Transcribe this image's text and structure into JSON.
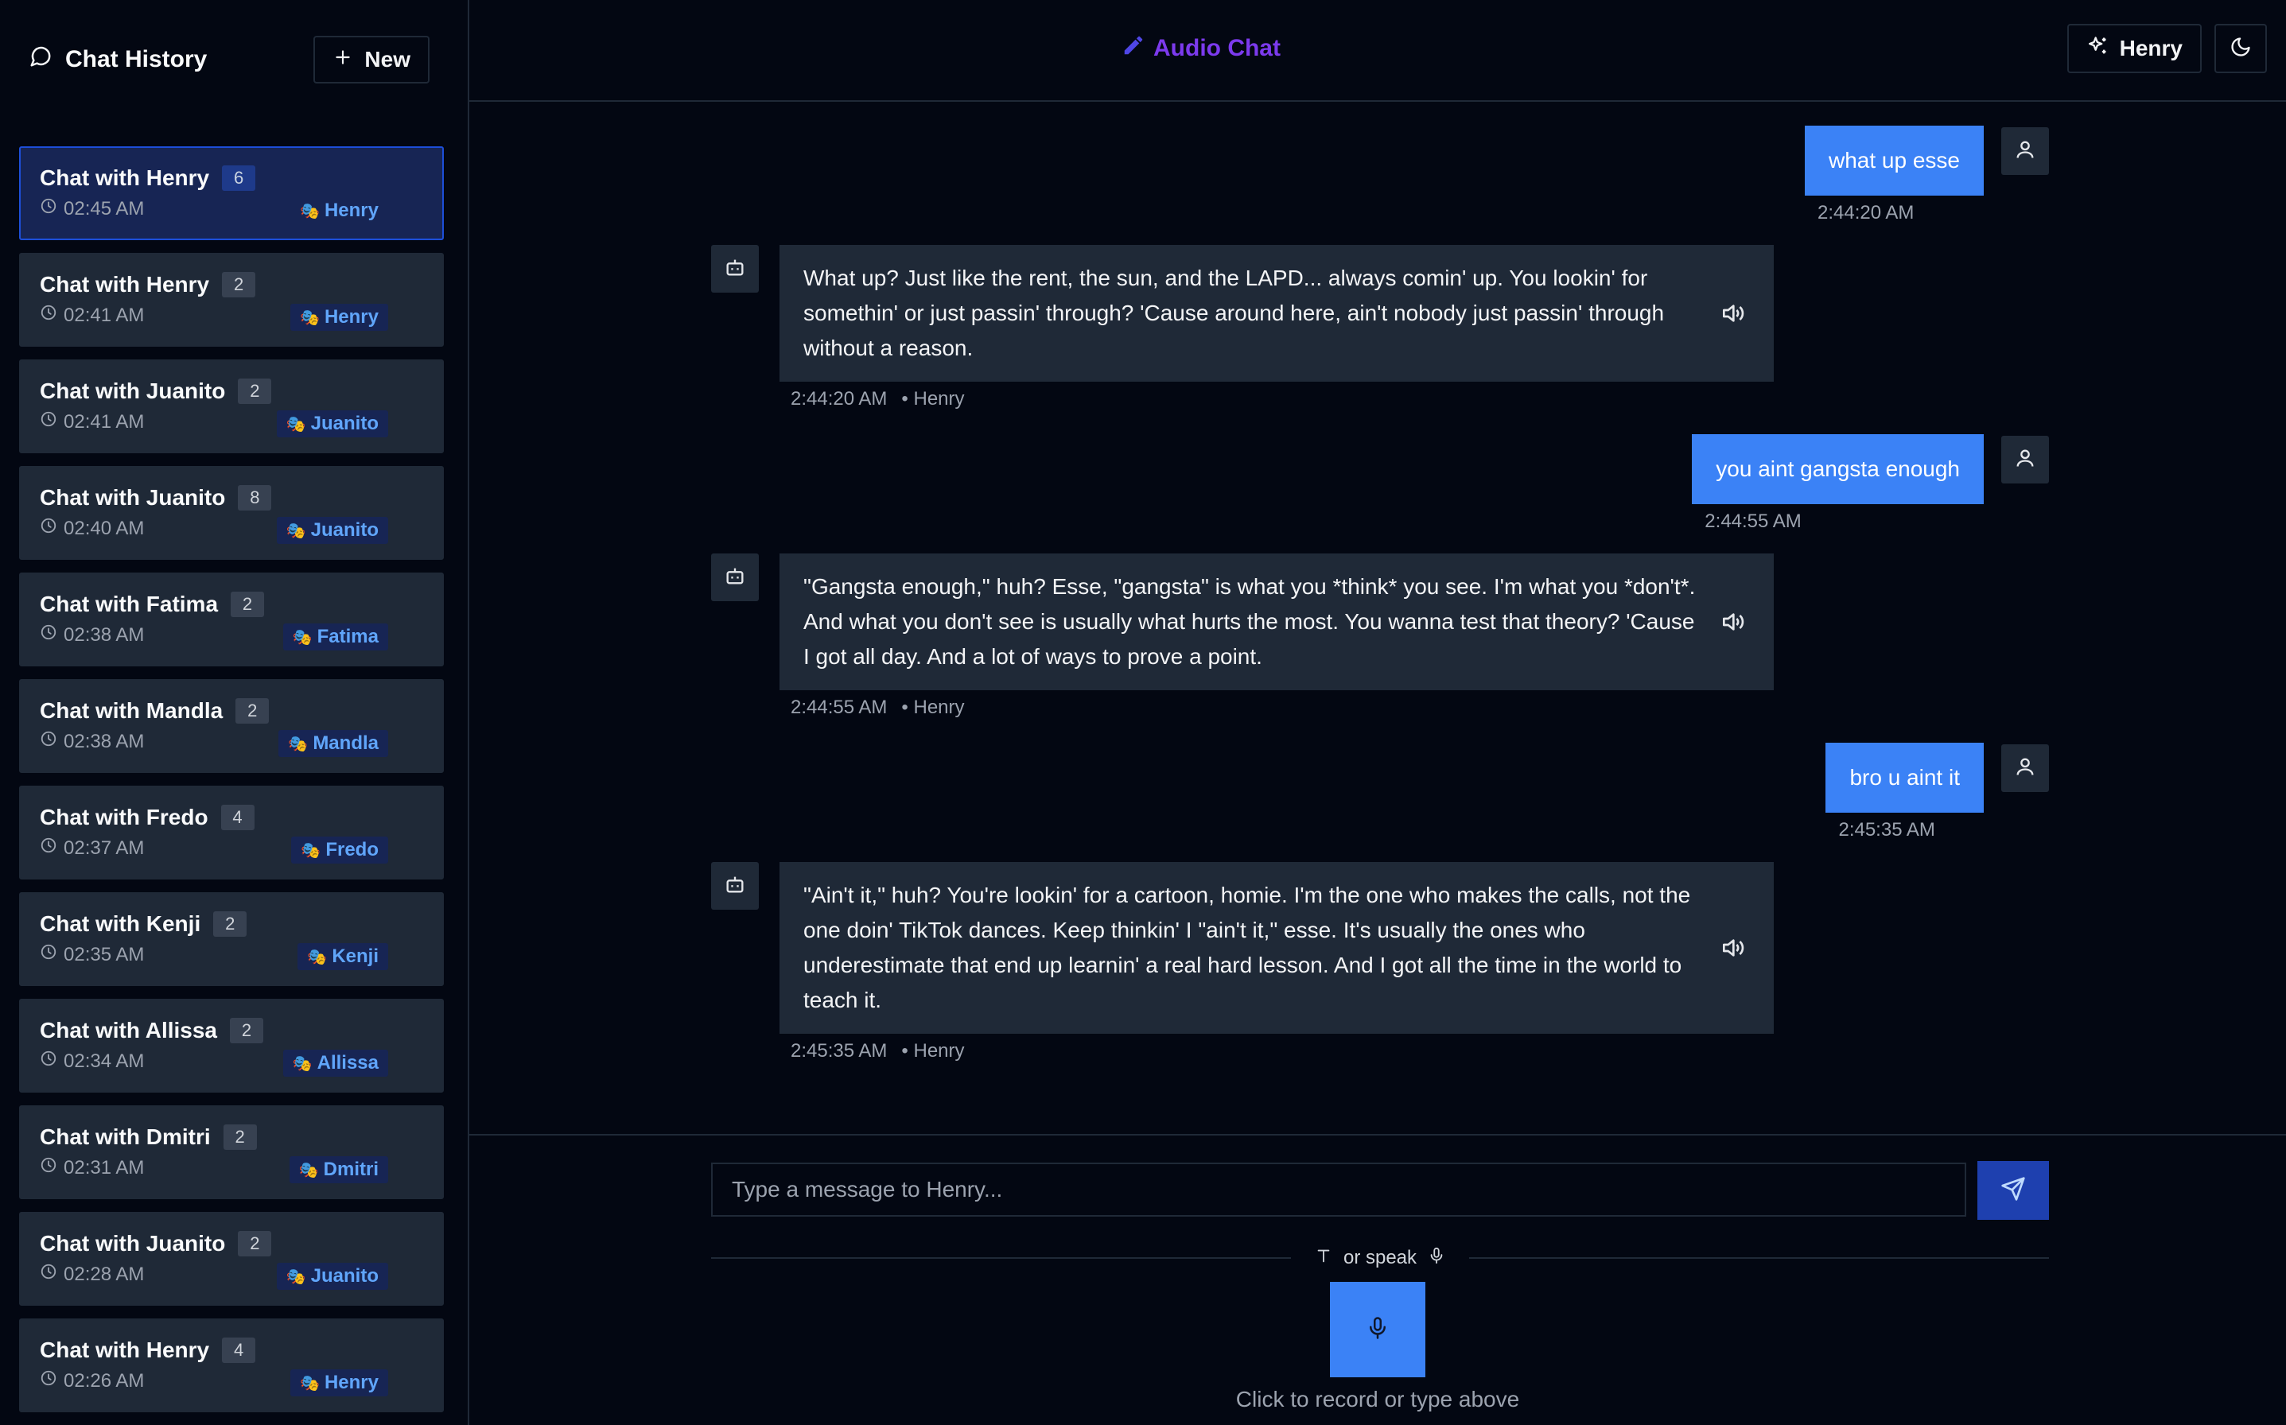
{
  "sidebar": {
    "title": "Chat History",
    "new_label": "New",
    "chats": [
      {
        "title": "Chat with Henry",
        "count": "6",
        "time": "02:45 AM",
        "persona": "Henry",
        "active": true
      },
      {
        "title": "Chat with Henry",
        "count": "2",
        "time": "02:41 AM",
        "persona": "Henry"
      },
      {
        "title": "Chat with Juanito",
        "count": "2",
        "time": "02:41 AM",
        "persona": "Juanito"
      },
      {
        "title": "Chat with Juanito",
        "count": "8",
        "time": "02:40 AM",
        "persona": "Juanito"
      },
      {
        "title": "Chat with Fatima",
        "count": "2",
        "time": "02:38 AM",
        "persona": "Fatima"
      },
      {
        "title": "Chat with Mandla",
        "count": "2",
        "time": "02:38 AM",
        "persona": "Mandla"
      },
      {
        "title": "Chat with Fredo",
        "count": "4",
        "time": "02:37 AM",
        "persona": "Fredo"
      },
      {
        "title": "Chat with Kenji",
        "count": "2",
        "time": "02:35 AM",
        "persona": "Kenji"
      },
      {
        "title": "Chat with Allissa",
        "count": "2",
        "time": "02:34 AM",
        "persona": "Allissa"
      },
      {
        "title": "Chat with Dmitri",
        "count": "2",
        "time": "02:31 AM",
        "persona": "Dmitri"
      },
      {
        "title": "Chat with Juanito",
        "count": "2",
        "time": "02:28 AM",
        "persona": "Juanito"
      },
      {
        "title": "Chat with Henry",
        "count": "4",
        "time": "02:26 AM",
        "persona": "Henry"
      }
    ]
  },
  "header": {
    "title": "Audio Chat",
    "persona_label": "Henry"
  },
  "messages": [
    {
      "role": "user",
      "text": "what up esse",
      "time": "2:44:20 AM"
    },
    {
      "role": "bot",
      "text": "What up? Just like the rent, the sun, and the LAPD... always comin' up. You lookin' for somethin' or just passin' through? 'Cause around here, ain't nobody just passin' through without a reason.",
      "time": "2:44:20 AM",
      "sender": "• Henry"
    },
    {
      "role": "user",
      "text": "you aint gangsta enough",
      "time": "2:44:55 AM"
    },
    {
      "role": "bot",
      "text": "\"Gangsta enough,\" huh? Esse, \"gangsta\" is what you *think* you see. I'm what you *don't*. And what you don't see is usually what hurts the most. You wanna test that theory? 'Cause I got all day. And a lot of ways to prove a point.",
      "time": "2:44:55 AM",
      "sender": "• Henry"
    },
    {
      "role": "user",
      "text": "bro u aint it",
      "time": "2:45:35 AM"
    },
    {
      "role": "bot",
      "text": "\"Ain't it,\" huh? You're lookin' for a cartoon, homie. I'm the one who makes the calls, not the one doin' TikTok dances. Keep thinkin' I \"ain't it,\" esse. It's usually the ones who underestimate that end up learnin' a real hard lesson. And I got all the time in the world to teach it.",
      "time": "2:45:35 AM",
      "sender": "• Henry"
    }
  ],
  "composer": {
    "placeholder": "Type a message to Henry...",
    "or_speak": "or speak",
    "hint": "Click to record or type above"
  },
  "colors": {
    "background": "#030712",
    "panel": "#1f2937",
    "accent": "#3b82f6",
    "title_accent": "#7c3aed",
    "badge_text": "#60a5fa"
  }
}
